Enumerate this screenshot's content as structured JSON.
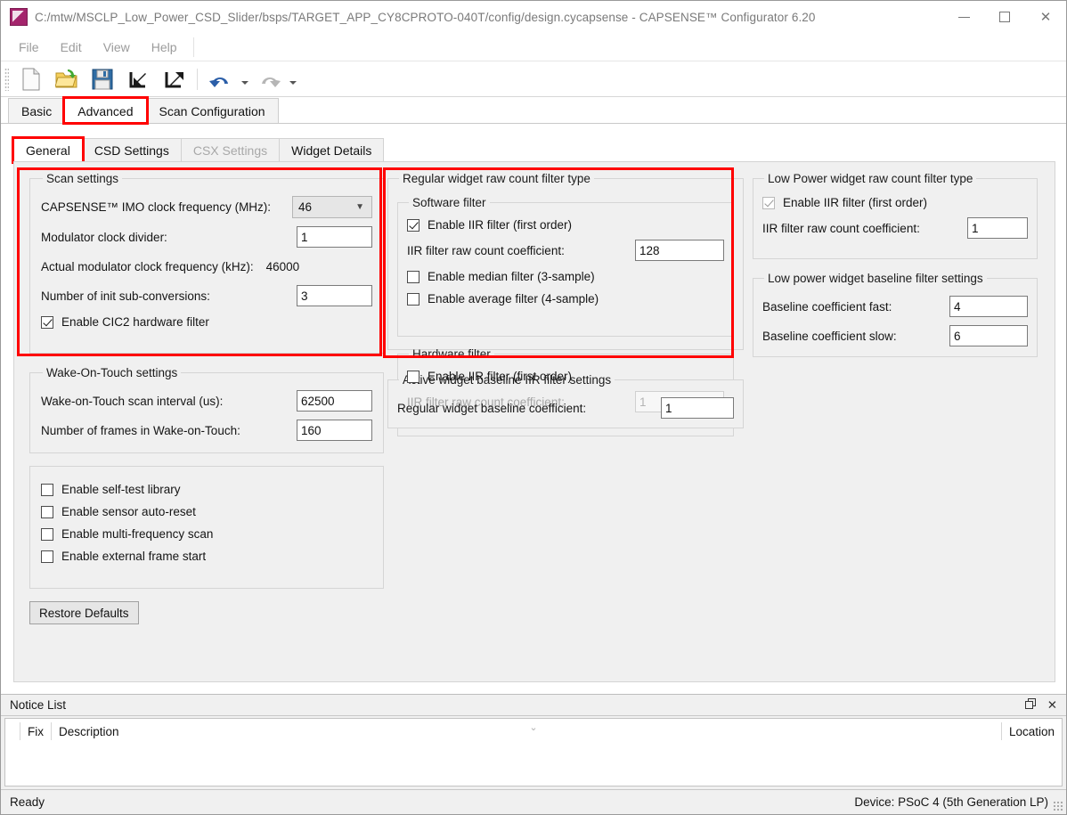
{
  "window": {
    "title": "C:/mtw/MSCLP_Low_Power_CSD_Slider/bsps/TARGET_APP_CY8CPROTO-040T/config/design.cycapsense - CAPSENSE™ Configurator 6.20",
    "icon": "capsense-app-icon",
    "minimize_label": "−",
    "maximize_label": "□",
    "close_label": "✕"
  },
  "menu": {
    "items": [
      {
        "label": "File"
      },
      {
        "label": "Edit"
      },
      {
        "label": "View"
      },
      {
        "label": "Help"
      }
    ]
  },
  "toolbar": {
    "buttons": [
      {
        "name": "new-icon",
        "tooltip": "New"
      },
      {
        "name": "open-folder-icon",
        "tooltip": "Open"
      },
      {
        "name": "save-floppy-icon",
        "tooltip": "Save"
      },
      {
        "name": "import-arrow-icon",
        "tooltip": "Import"
      },
      {
        "name": "export-arrow-icon",
        "tooltip": "Export"
      },
      {
        "name": "undo-arrow-icon",
        "tooltip": "Undo"
      },
      {
        "name": "redo-arrow-icon",
        "tooltip": "Redo"
      }
    ]
  },
  "outer_tabs": [
    {
      "label": "Basic",
      "active": false,
      "highlighted": false
    },
    {
      "label": "Advanced",
      "active": true,
      "highlighted": true
    },
    {
      "label": "Scan Configuration",
      "active": false,
      "highlighted": false
    }
  ],
  "inner_tabs": [
    {
      "label": "General",
      "active": true,
      "disabled": false,
      "highlighted": true
    },
    {
      "label": "CSD Settings",
      "active": false,
      "disabled": false,
      "highlighted": false
    },
    {
      "label": "CSX Settings",
      "active": false,
      "disabled": true,
      "highlighted": false
    },
    {
      "label": "Widget Details",
      "active": false,
      "disabled": false,
      "highlighted": false
    }
  ],
  "scan_settings": {
    "legend": "Scan settings",
    "imo_label": "CAPSENSE™ IMO clock frequency (MHz):",
    "imo_value": "46",
    "imo_chevron": "⌄",
    "mod_div_label": "Modulator clock divider:",
    "mod_div_value": "1",
    "actual_label": "Actual modulator clock frequency (kHz):",
    "actual_value": "46000",
    "init_sub_label": "Number of init sub-conversions:",
    "init_sub_value": "3",
    "cic2_label": "Enable CIC2 hardware filter",
    "cic2_checked": true
  },
  "wake_on_touch": {
    "legend": "Wake-On-Touch settings",
    "interval_label": "Wake-on-Touch scan interval (us):",
    "interval_value": "62500",
    "frames_label": "Number of frames in Wake-on-Touch:",
    "frames_value": "160"
  },
  "misc_options": [
    {
      "label": "Enable self-test library",
      "checked": false
    },
    {
      "label": "Enable sensor auto-reset",
      "checked": false
    },
    {
      "label": "Enable multi-frequency scan",
      "checked": false
    },
    {
      "label": "Enable external frame start",
      "checked": false
    }
  ],
  "restore_defaults_label": "Restore Defaults",
  "regular_filter": {
    "legend": "Regular widget raw count filter type",
    "software": {
      "legend": "Software filter",
      "iir_label": "Enable IIR filter (first order)",
      "iir_checked": true,
      "coeff_label": "IIR filter raw count coefficient:",
      "coeff_value": "128",
      "median_label": "Enable median filter (3-sample)",
      "median_checked": false,
      "average_label": "Enable average filter (4-sample)",
      "average_checked": false
    },
    "hardware": {
      "legend": "Hardware filter",
      "iir_label": "Enable IIR filter (first order)",
      "iir_checked": false,
      "coeff_label": "IIR filter raw count coefficient:",
      "coeff_value": "1"
    }
  },
  "active_baseline": {
    "legend": "Active widget baseline IIR filter settings",
    "coeff_label": "Regular widget baseline coefficient:",
    "coeff_value": "1"
  },
  "low_power_filter": {
    "legend": "Low Power widget raw count filter type",
    "iir_label": "Enable IIR filter (first order)",
    "iir_checked": true,
    "coeff_label": "IIR filter raw count coefficient:",
    "coeff_value": "1"
  },
  "low_power_baseline": {
    "legend": "Low power widget baseline filter settings",
    "fast_label": "Baseline coefficient fast:",
    "fast_value": "4",
    "slow_label": "Baseline coefficient slow:",
    "slow_value": "6"
  },
  "notice_list": {
    "title": "Notice List",
    "undock_label": "❐",
    "close_label": "✕",
    "chevron": "⌄",
    "columns": [
      "Fix",
      "Description",
      "Location"
    ],
    "rows": []
  },
  "status_bar": {
    "left": "Ready",
    "right": "Device: PSoC 4 (5th Generation LP)"
  },
  "colors": {
    "highlight": "#ff0000",
    "panel_bg": "#f0f0f0",
    "accent_blue": "#2f5fa8"
  }
}
